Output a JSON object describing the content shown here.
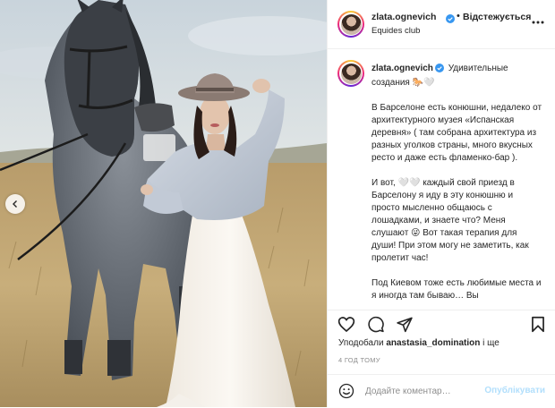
{
  "post": {
    "username": "zlata.ognevich",
    "separator": "•",
    "unfollow_label": "Відстежується",
    "location": "Equides club",
    "caption": {
      "username": "zlata.ognevich",
      "first_line": "Удивительные создания 🐎🤍",
      "paragraphs": [
        "В Барселоне есть конюшни, недалеко от архитектурного музея «Испанская деревня» ( там собрана архитектура из разных уголков страны, много вкусных ресто и даже есть фламенко-бар ).",
        "И вот, 🤍🤍 каждый свой приезд в Барселону я иду в эту конюшню и просто мысленно общаюсь с лошадками, и знаете что? Меня слушают 😜 Вот такая терапия для души! При этом могу не заметить, как пролетит час!",
        "Под Киевом тоже есть любимые места и я иногда там бываю… Вы"
      ]
    },
    "likes": {
      "prefix": "Уподобали",
      "user": "anastasia_domination",
      "suffix": "і ще"
    },
    "time_ago": "4 год тому",
    "comment_box": {
      "placeholder": "Додайте коментар…",
      "post_label": "Опублікувати"
    }
  },
  "icons": {
    "verified": "verified-badge-icon",
    "more": "more-options-icon",
    "like": "heart-icon",
    "comment": "comment-bubble-icon",
    "share": "paper-plane-icon",
    "save": "bookmark-icon",
    "emoji": "emoji-smile-icon",
    "carousel": "chevron-left-icon"
  },
  "colors": {
    "text": "#262626",
    "muted": "#8e8e8e",
    "verified_blue": "#3897f0",
    "post_button_disabled": "#b2dffc",
    "divider": "#efefef"
  }
}
